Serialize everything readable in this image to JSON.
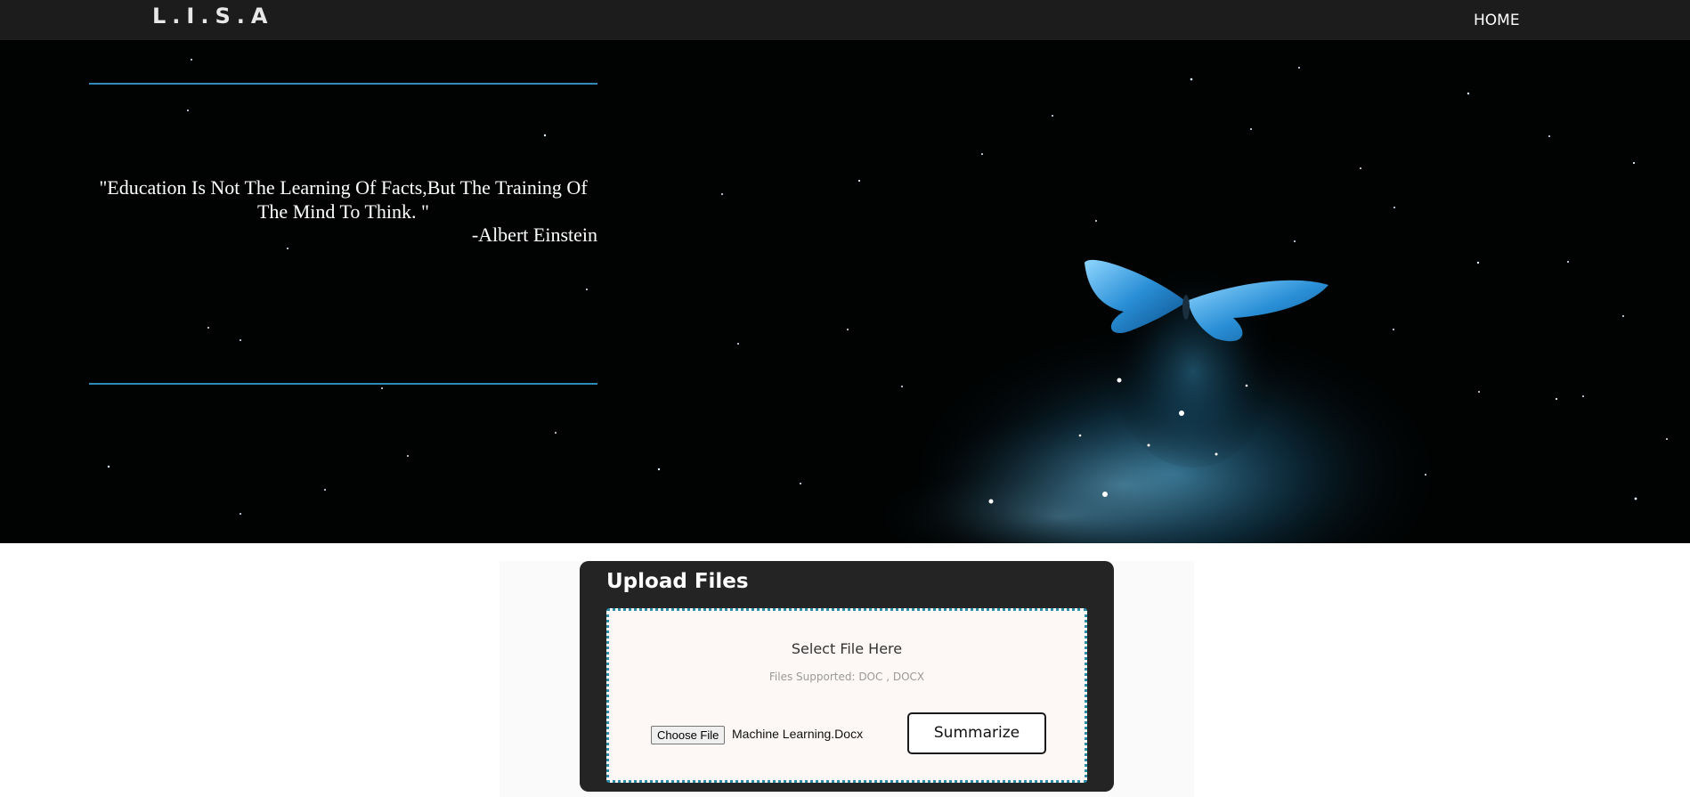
{
  "nav": {
    "logo": "L.I.S.A",
    "home_label": "HOME"
  },
  "hero": {
    "quote": "\"Education Is Not The Learning Of Facts,But The Training Of The Mind To Think. \"",
    "author": "-Albert Einstein"
  },
  "upload": {
    "title": "Upload Files",
    "select_text": "Select File Here",
    "supported_text": "Files Supported: DOC , DOCX",
    "choose_file_label": "Choose File",
    "file_name": "Machine Learning.Docx",
    "summarize_label": "Summarize"
  },
  "colors": {
    "topbar": "#1c1c1c",
    "hero_background": "#010303",
    "accent_line": "#2d8bb8",
    "card": "#242424",
    "dropzone_border": "#2a8ca8",
    "butterfly": "#3aa6e8"
  },
  "icons": [
    "butterfly-image",
    "starfield-background"
  ]
}
